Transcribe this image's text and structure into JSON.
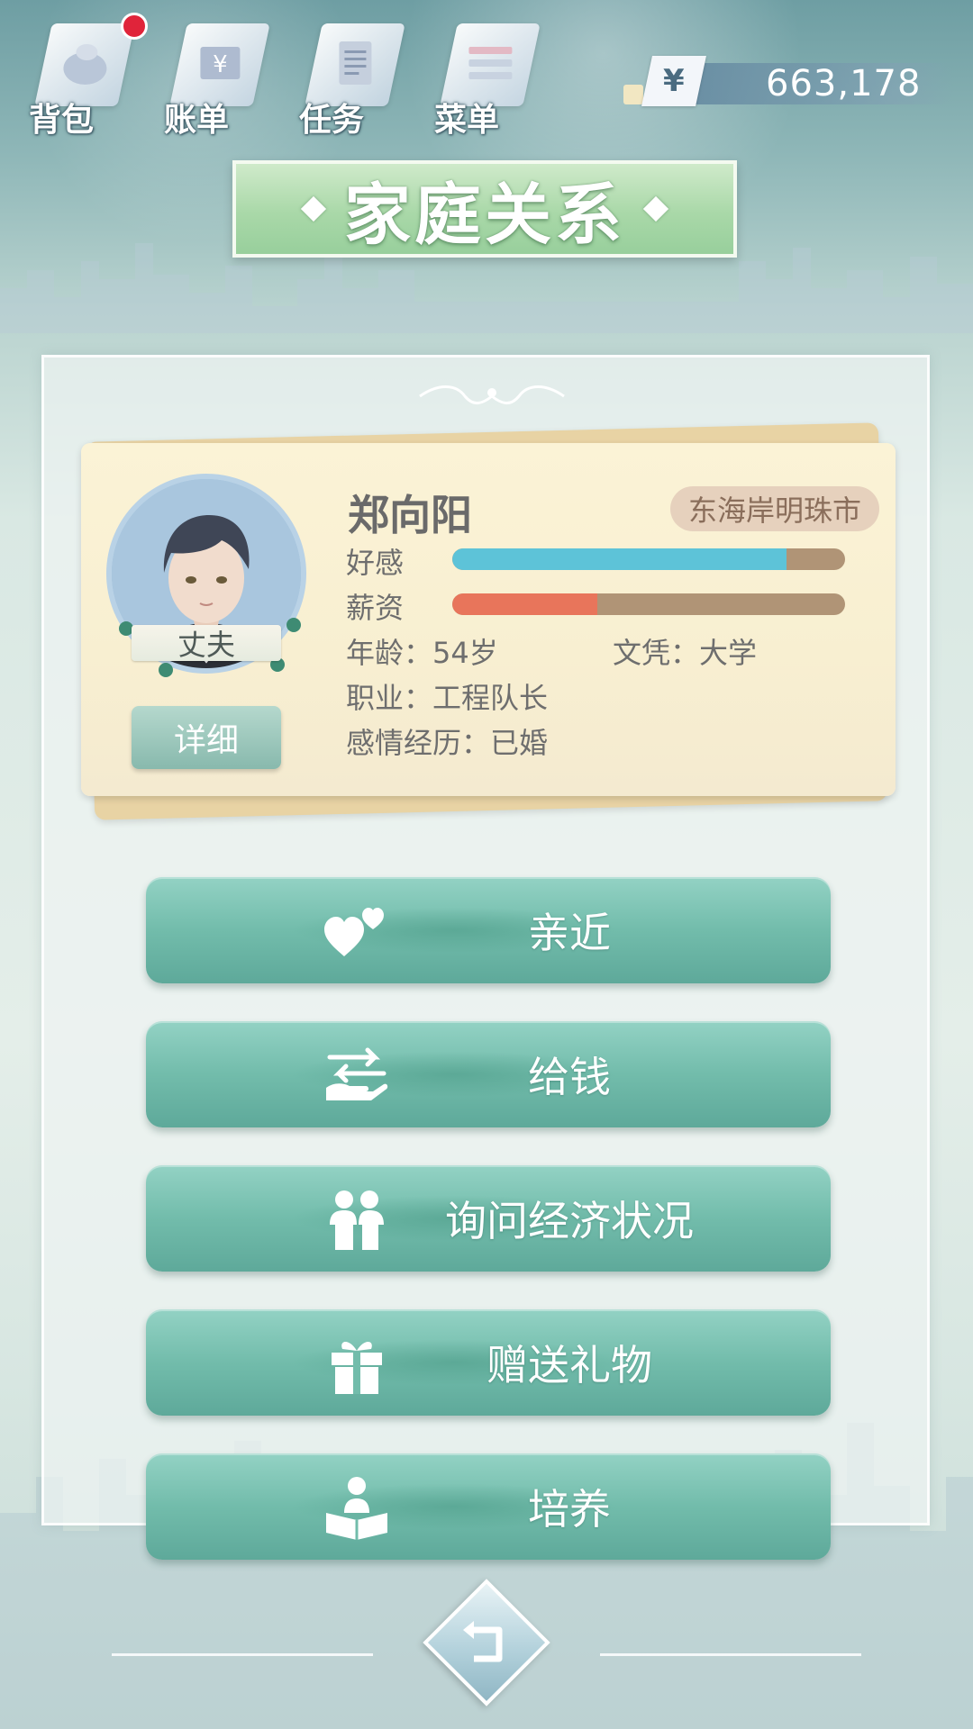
{
  "topnav": {
    "items": [
      {
        "label": "背包",
        "icon": "backpack-icon",
        "has_notification": true
      },
      {
        "label": "账单",
        "icon": "bill-icon",
        "has_notification": false
      },
      {
        "label": "任务",
        "icon": "task-icon",
        "has_notification": false
      },
      {
        "label": "菜单",
        "icon": "menu-icon",
        "has_notification": false
      }
    ]
  },
  "currency": {
    "symbol": "¥",
    "amount": "663,178"
  },
  "page": {
    "title": "家庭关系"
  },
  "character": {
    "name": "郑向阳",
    "role": "丈夫",
    "city": "东海岸明珠市",
    "favor_label": "好感",
    "favor_level": 0.85,
    "favor_color": "#5dc3d8",
    "salary_label": "薪资",
    "salary_level": 0.37,
    "salary_color": "#e8755b",
    "age_line": "年龄：54岁",
    "education_line": "文凭：大学",
    "job_line": "职业：工程队长",
    "relationship_line": "感情经历：已婚",
    "detail_label": "详细"
  },
  "actions": [
    {
      "label": "亲近",
      "icon": "hearts-icon"
    },
    {
      "label": "给钱",
      "icon": "give-money-icon"
    },
    {
      "label": "询问经济状况",
      "icon": "people-talk-icon"
    },
    {
      "label": "赠送礼物",
      "icon": "gift-icon"
    },
    {
      "label": "培养",
      "icon": "reading-person-icon"
    }
  ],
  "back": {
    "icon": "back-arrow-icon"
  }
}
